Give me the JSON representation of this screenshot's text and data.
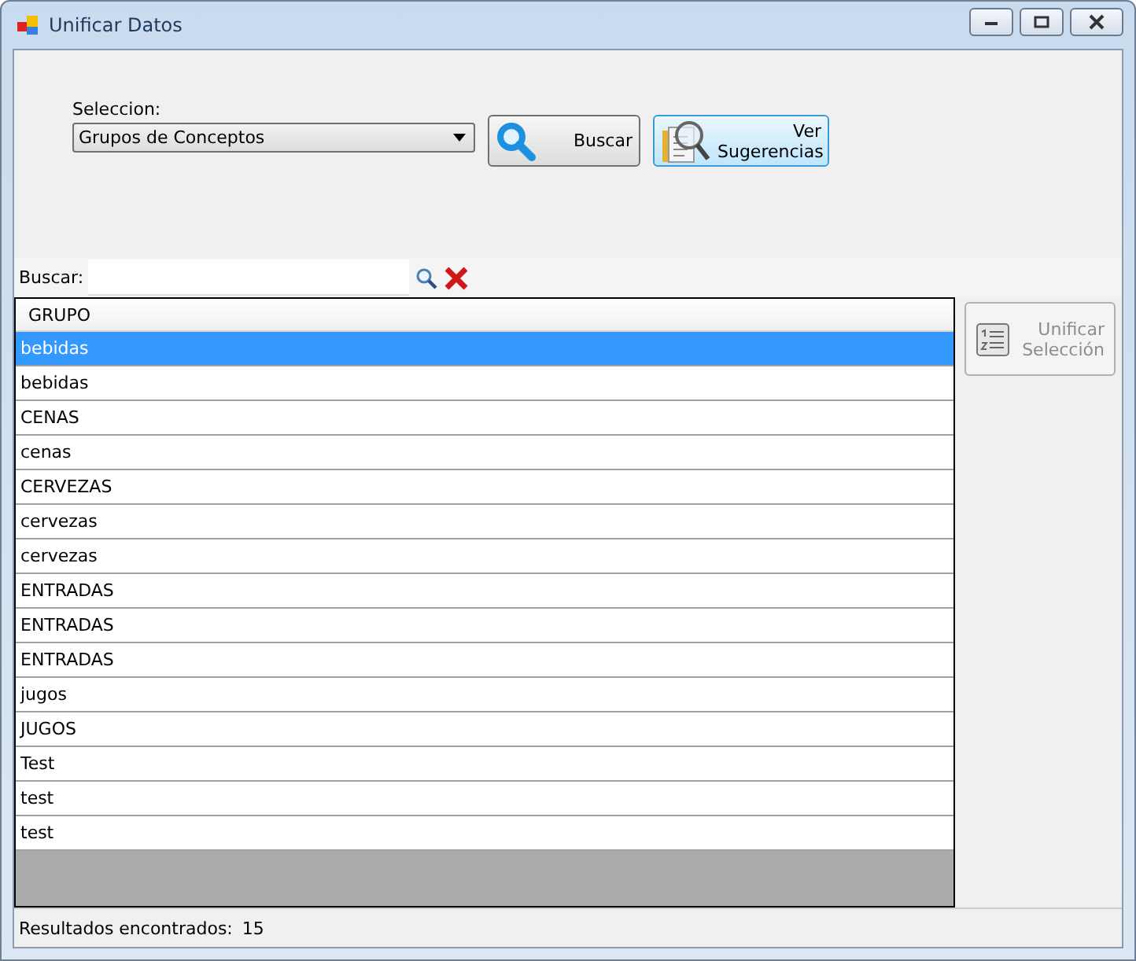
{
  "window": {
    "title": "Unificar Datos"
  },
  "seleccion": {
    "label": "Seleccion:",
    "value": "Grupos de Conceptos"
  },
  "buttons": [
    {
      "kind": "search",
      "label": "Buscar",
      "focused": false
    },
    {
      "kind": "suggest",
      "label": "Ver Sugerencias",
      "focused": true
    }
  ],
  "search": {
    "label": "Buscar:"
  },
  "table": {
    "columns": [
      "GRUPO"
    ],
    "rows": [
      {
        "cells": [
          "bebidas"
        ],
        "selected": true
      },
      {
        "cells": [
          "bebidas"
        ],
        "selected": false
      },
      {
        "cells": [
          "CENAS"
        ],
        "selected": false
      },
      {
        "cells": [
          "cenas"
        ],
        "selected": false
      },
      {
        "cells": [
          "CERVEZAS"
        ],
        "selected": false
      },
      {
        "cells": [
          "cervezas"
        ],
        "selected": false
      },
      {
        "cells": [
          "cervezas"
        ],
        "selected": false
      },
      {
        "cells": [
          "ENTRADAS"
        ],
        "selected": false
      },
      {
        "cells": [
          "ENTRADAS"
        ],
        "selected": false
      },
      {
        "cells": [
          "ENTRADAS"
        ],
        "selected": false
      },
      {
        "cells": [
          "jugos"
        ],
        "selected": false
      },
      {
        "cells": [
          "JUGOS"
        ],
        "selected": false
      },
      {
        "cells": [
          "Test"
        ],
        "selected": false
      },
      {
        "cells": [
          "test"
        ],
        "selected": false
      },
      {
        "cells": [
          "test"
        ],
        "selected": false
      }
    ]
  },
  "unify_button": {
    "label": "Unificar Selección",
    "disabled": true
  },
  "status_bar": {
    "label": "Resultados encontrados:",
    "count": "15"
  }
}
